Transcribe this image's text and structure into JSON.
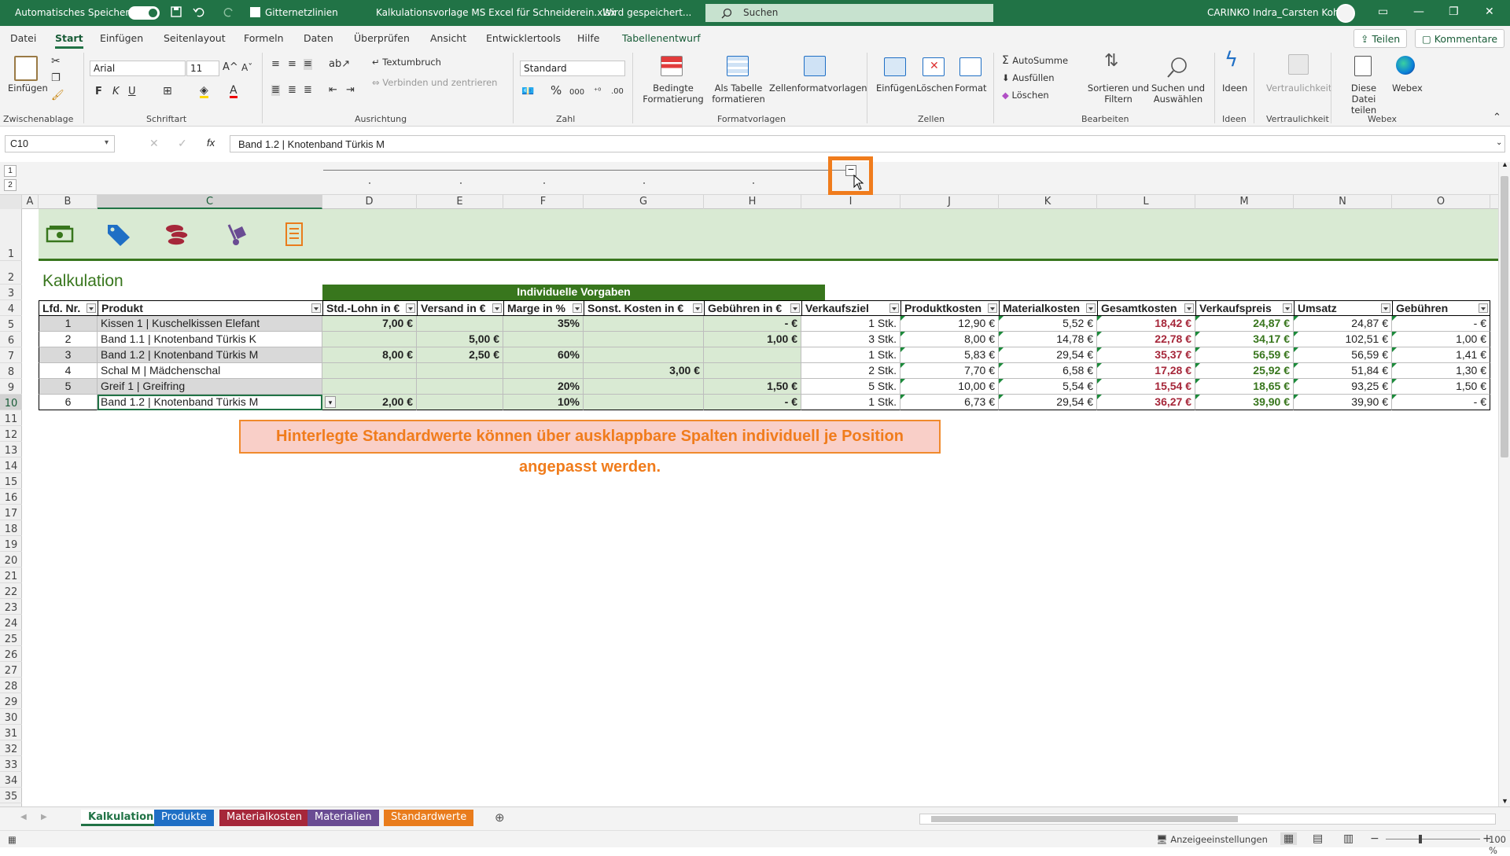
{
  "titlebar": {
    "autosave_label": "Automatisches Speichern",
    "gridlines_label": "Gitternetzlinien",
    "filename": "Kalkulationsvorlage MS Excel für Schneiderein.xlsx",
    "save_status": "Wird gespeichert...",
    "search_placeholder": "Suchen",
    "user": "CARINKO Indra_Carsten Kohl"
  },
  "menu": {
    "items": [
      "Datei",
      "Start",
      "Einfügen",
      "Seitenlayout",
      "Formeln",
      "Daten",
      "Überprüfen",
      "Ansicht",
      "Entwicklertools",
      "Hilfe",
      "Tabellenentwurf"
    ],
    "share": "Teilen",
    "comments": "Kommentare"
  },
  "ribbon": {
    "clipboard": {
      "paste": "Einfügen",
      "group": "Zwischenablage"
    },
    "font": {
      "name": "Arial",
      "size": "11",
      "bold": "F",
      "italic": "K",
      "underline": "U",
      "group": "Schriftart"
    },
    "alignment": {
      "wrap": "Textumbruch",
      "merge": "Verbinden und zentrieren",
      "group": "Ausrichtung"
    },
    "number": {
      "format": "Standard",
      "group": "Zahl"
    },
    "styles": {
      "conditional": "Bedingte Formatierung",
      "as_table": "Als Tabelle formatieren",
      "cell_styles": "Zellenformatvorlagen",
      "group": "Formatvorlagen"
    },
    "cells": {
      "insert": "Einfügen",
      "delete": "Löschen",
      "format": "Format",
      "group": "Zellen"
    },
    "editing": {
      "autosum": "AutoSumme",
      "fill": "Ausfüllen",
      "clear": "Löschen",
      "sort": "Sortieren und Filtern",
      "find": "Suchen und Auswählen",
      "group": "Bearbeiten"
    },
    "ideas": {
      "label": "Ideen",
      "group": "Ideen"
    },
    "sensitivity": {
      "label": "Vertraulichkeit",
      "group": "Vertraulichkeit"
    },
    "webex": {
      "share_file": "Diese Datei teilen",
      "webex": "Webex",
      "group": "Webex"
    }
  },
  "formula": {
    "namebox": "C10",
    "content": "Band 1.2 | Knotenband Türkis M"
  },
  "outline_levels": [
    "1",
    "2"
  ],
  "columns": [
    "A",
    "B",
    "C",
    "D",
    "E",
    "F",
    "G",
    "H",
    "I",
    "J",
    "K",
    "L",
    "M",
    "N",
    "O"
  ],
  "rows": [
    "1",
    "2",
    "3",
    "4",
    "5",
    "6",
    "7",
    "8",
    "9",
    "10",
    "11",
    "12",
    "13",
    "14",
    "15",
    "16",
    "17",
    "18",
    "19",
    "20",
    "21",
    "22",
    "23",
    "24",
    "25",
    "26",
    "27",
    "28",
    "29",
    "30",
    "31",
    "32",
    "33",
    "34",
    "35"
  ],
  "sheet": {
    "title": "Kalkulation",
    "group_header": "Individuelle Vorgaben",
    "headers": [
      "Lfd. Nr.",
      "Produkt",
      "Std.-Lohn in €",
      "Versand in €",
      "Marge in %",
      "Sonst. Kosten in €",
      "Gebühren in €",
      "Verkaufsziel",
      "Produktkosten",
      "Materialkosten",
      "Gesamtkosten",
      "Verkaufspreis",
      "Umsatz",
      "Gebühren"
    ],
    "data": [
      [
        "1",
        "Kissen 1 | Kuschelkissen Elefant",
        "7,00 €",
        "",
        "35%",
        "",
        "-   €",
        "1 Stk.",
        "12,90 €",
        "5,52 €",
        "18,42 €",
        "24,87 €",
        "24,87 €",
        "-   €"
      ],
      [
        "2",
        "Band 1.1 | Knotenband Türkis K",
        "",
        "5,00 €",
        "",
        "",
        "1,00 €",
        "3 Stk.",
        "8,00 €",
        "14,78 €",
        "22,78 €",
        "34,17 €",
        "102,51 €",
        "1,00 €"
      ],
      [
        "3",
        "Band 1.2 | Knotenband Türkis M",
        "8,00 €",
        "2,50 €",
        "60%",
        "",
        "",
        "1 Stk.",
        "5,83 €",
        "29,54 €",
        "35,37 €",
        "56,59 €",
        "56,59 €",
        "1,41 €"
      ],
      [
        "4",
        "Schal M | Mädchenschal",
        "",
        "",
        "",
        "3,00 €",
        "",
        "2 Stk.",
        "7,70 €",
        "6,58 €",
        "17,28 €",
        "25,92 €",
        "51,84 €",
        "1,30 €"
      ],
      [
        "5",
        "Greif 1 | Greifring",
        "",
        "",
        "20%",
        "",
        "1,50 €",
        "5 Stk.",
        "10,00 €",
        "5,54 €",
        "15,54 €",
        "18,65 €",
        "93,25 €",
        "1,50 €"
      ],
      [
        "6",
        "Band 1.2 | Knotenband Türkis M",
        "2,00 €",
        "",
        "10%",
        "",
        "-   €",
        "1 Stk.",
        "6,73 €",
        "29,54 €",
        "36,27 €",
        "39,90 €",
        "39,90 €",
        "-   €"
      ]
    ],
    "note": "Hinterlegte Standardwerte können über ausklappbare Spalten individuell je Position angepasst werden."
  },
  "tabs": [
    "Kalkulation",
    "Produkte",
    "Materialkosten",
    "Materialien",
    "Standardwerte"
  ],
  "tab_colors": [
    "#ffffff",
    "#1f6fc5",
    "#a6273a",
    "#6a4c93",
    "#e97c1c"
  ],
  "status": {
    "display_settings": "Anzeigeeinstellungen",
    "zoom": "100 %"
  }
}
